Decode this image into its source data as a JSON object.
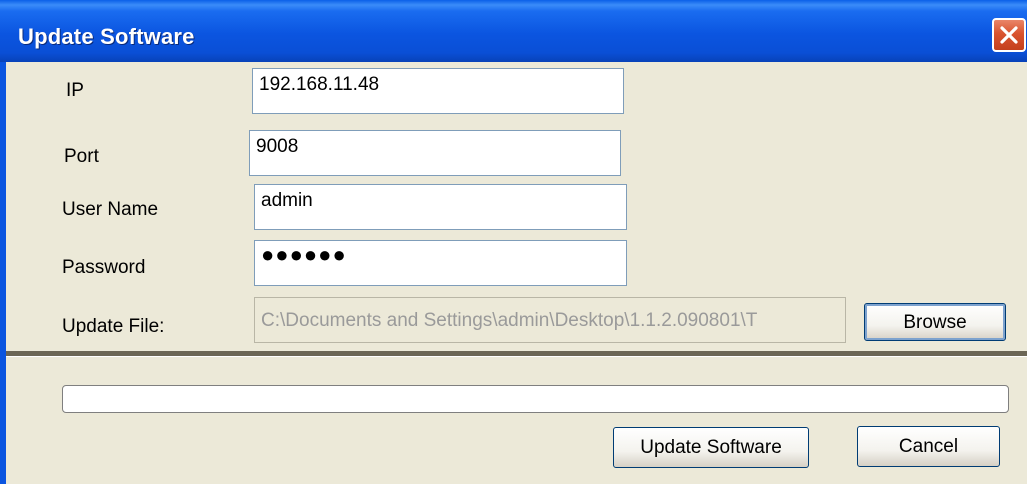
{
  "window": {
    "title": "Update Software"
  },
  "form": {
    "ip_label": "IP",
    "ip_value": "192.168.11.48",
    "port_label": "Port",
    "port_value": "9008",
    "username_label": "User Name",
    "username_value": "admin",
    "password_label": "Password",
    "password_mask": "●●●●●●",
    "update_file_label": "Update File:",
    "update_file_value": "C:\\Documents and Settings\\admin\\Desktop\\1.1.2.090801\\T",
    "browse_label": "Browse"
  },
  "progress": {
    "value": 0
  },
  "actions": {
    "update_label": "Update Software",
    "cancel_label": "Cancel"
  },
  "icons": {
    "close": "close-icon"
  },
  "colors": {
    "titlebar": "#0b55e0",
    "dialog_bg": "#ece9d8",
    "close_button": "#d9532f"
  }
}
